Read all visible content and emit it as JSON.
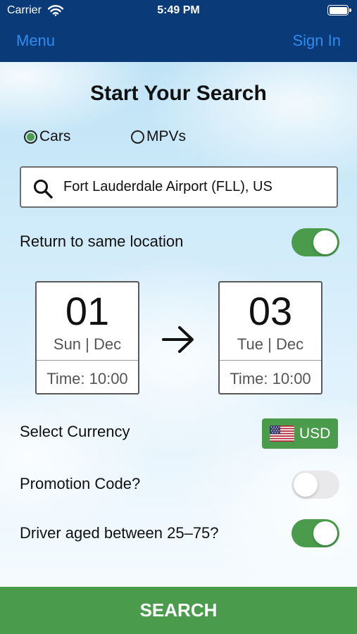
{
  "status_bar": {
    "carrier": "Carrier",
    "time": "5:49 PM"
  },
  "nav": {
    "menu_label": "Menu",
    "sign_in_label": "Sign In"
  },
  "page": {
    "title": "Start Your Search"
  },
  "vehicle_types": [
    {
      "label": "Cars",
      "selected": true
    },
    {
      "label": "MPVs",
      "selected": false
    }
  ],
  "search": {
    "location_value": "Fort Lauderdale Airport (FLL), US"
  },
  "options": {
    "return_same_location": {
      "label": "Return to same location",
      "on": true
    },
    "select_currency": {
      "label": "Select Currency",
      "code": "USD",
      "flag_icon": "us-flag-icon"
    },
    "promotion_code": {
      "label": "Promotion Code?",
      "on": false
    },
    "driver_age": {
      "label": "Driver aged between 25–75?",
      "on": true
    }
  },
  "pickup": {
    "day": "01",
    "weekday_month": "Sun | Dec",
    "time": "Time: 10:00"
  },
  "dropoff": {
    "day": "03",
    "weekday_month": "Tue | Dec",
    "time": "Time: 10:00"
  },
  "search_button_label": "SEARCH",
  "colors": {
    "navbar": "#0a3a78",
    "link": "#2e8cf0",
    "accent_green": "#4a9b4c"
  }
}
